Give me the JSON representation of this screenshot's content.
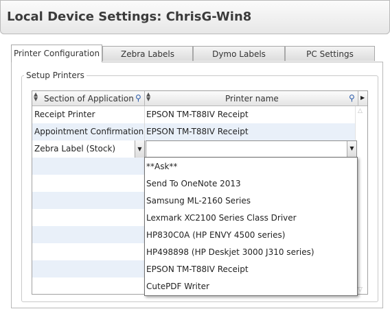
{
  "window": {
    "title": "Local Device Settings: ChrisG-Win8"
  },
  "tabs": [
    {
      "label": "Printer Configuration",
      "active": true
    },
    {
      "label": "Zebra Labels",
      "active": false
    },
    {
      "label": "Dymo Labels",
      "active": false
    },
    {
      "label": "PC Settings",
      "active": false
    }
  ],
  "setup": {
    "legend": "Setup Printers",
    "columns": {
      "section": "Section of Application",
      "printer": "Printer name"
    },
    "rows": [
      {
        "section": "Receipt Printer",
        "printer": "EPSON TM-T88IV Receipt"
      },
      {
        "section": "Appointment Confirmation",
        "printer": "EPSON TM-T88IV Receipt"
      },
      {
        "section": "Zebra Label (Stock)",
        "printer": ""
      }
    ],
    "printer_options": [
      "**Ask**",
      "Send To OneNote 2013",
      "Samsung ML-2160 Series",
      "Lexmark XC2100 Series Class Driver",
      "HP830C0A (HP ENVY 4500 series)",
      "HP498898 (HP Deskjet 3000 J310 series)",
      "EPSON TM-T88IV Receipt",
      "CutePDF Writer"
    ]
  },
  "icons": {
    "search": "magnifier-icon",
    "sort": "sort-arrows-icon",
    "dropdown": "chevron-down-icon"
  },
  "colors": {
    "row_alt": "#e9f0f9",
    "search_icon": "#2a5aa8"
  }
}
